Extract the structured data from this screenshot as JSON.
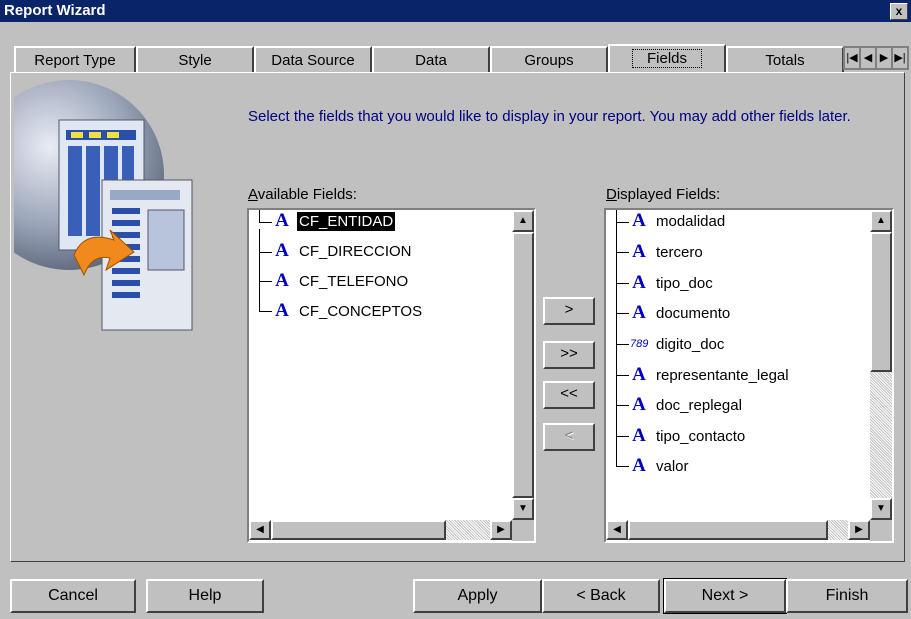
{
  "window": {
    "title": "Report Wizard",
    "close_glyph": "x"
  },
  "tabs": [
    {
      "label": "Report Type"
    },
    {
      "label": "Style"
    },
    {
      "label": "Data Source"
    },
    {
      "label": "Data"
    },
    {
      "label": "Groups"
    },
    {
      "label": "Fields",
      "active": true
    },
    {
      "label": "Totals"
    }
  ],
  "tab_scroll_icons": [
    "first-arrow-icon",
    "prev-arrow-icon",
    "next-arrow-icon",
    "last-arrow-icon"
  ],
  "instructions": "Select the fields that you would like to display in your report. You may add other fields later.",
  "available": {
    "label_prefix": "A",
    "label_rest": "vailable Fields:",
    "items": [
      {
        "icon": "character-field-icon",
        "glyph": "A",
        "name": "CF_ENTIDAD",
        "selected": true
      },
      {
        "icon": "character-field-icon",
        "glyph": "A",
        "name": "CF_DIRECCION"
      },
      {
        "icon": "character-field-icon",
        "glyph": "A",
        "name": "CF_TELEFONO"
      },
      {
        "icon": "character-field-icon",
        "glyph": "A",
        "name": "CF_CONCEPTOS"
      }
    ]
  },
  "displayed": {
    "label_prefix": "D",
    "label_rest": "isplayed Fields:",
    "items": [
      {
        "icon": "character-field-icon",
        "glyph": "A",
        "name": "modalidad"
      },
      {
        "icon": "character-field-icon",
        "glyph": "A",
        "name": "tercero"
      },
      {
        "icon": "character-field-icon",
        "glyph": "A",
        "name": "tipo_doc"
      },
      {
        "icon": "character-field-icon",
        "glyph": "A",
        "name": "documento"
      },
      {
        "icon": "number-field-icon",
        "glyph": "789",
        "name": "digito_doc"
      },
      {
        "icon": "character-field-icon",
        "glyph": "A",
        "name": "representante_legal"
      },
      {
        "icon": "character-field-icon",
        "glyph": "A",
        "name": "doc_replegal"
      },
      {
        "icon": "character-field-icon",
        "glyph": "A",
        "name": "tipo_contacto"
      },
      {
        "icon": "character-field-icon",
        "glyph": "A",
        "name": "valor"
      }
    ]
  },
  "move_buttons": {
    "add_one": ">",
    "add_all": ">>",
    "remove_all": "<<",
    "remove_one": "<"
  },
  "footer": {
    "cancel": "Cancel",
    "help": "Help",
    "apply": "Apply",
    "back": "< Back",
    "next": "Next >",
    "finish": "Finish"
  },
  "colors": {
    "titlebar": "#0a246a",
    "instructions": "#000080",
    "icon_blue": "#0000c0",
    "face": "#c0c0c0"
  }
}
